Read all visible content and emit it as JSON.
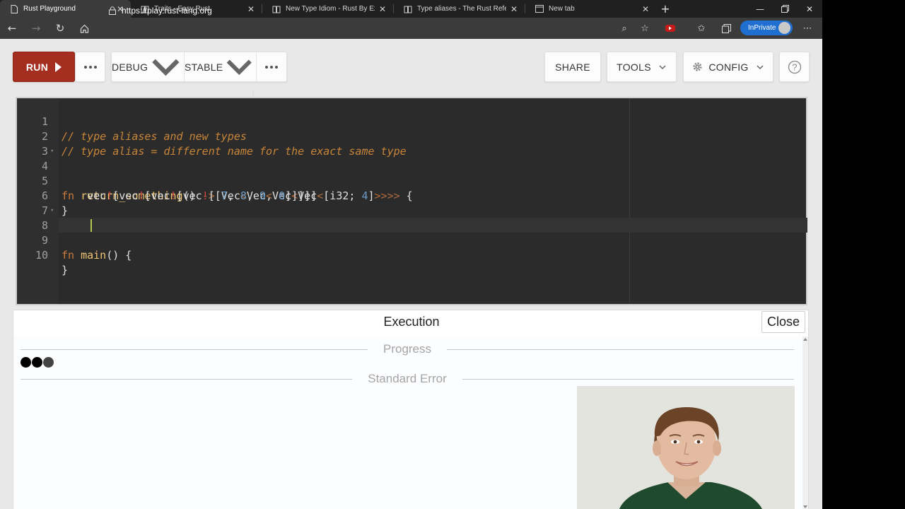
{
  "browser": {
    "tabs": [
      {
        "title": "Rust Playground",
        "active": true
      },
      {
        "title": "Traits - Easy Rust",
        "active": false
      },
      {
        "title": "New Type Idiom - Rust By Example",
        "active": false
      },
      {
        "title": "Type aliases - The Rust Reference",
        "active": false
      },
      {
        "title": "New tab",
        "active": false
      }
    ],
    "url": "https://play.rust-lang.org",
    "inprivate_label": "InPrivate"
  },
  "toolbar": {
    "run_label": "RUN",
    "debug_label": "DEBUG",
    "stable_label": "STABLE",
    "share_label": "SHARE",
    "tools_label": "TOOLS",
    "config_label": "CONFIG",
    "help_label": "?"
  },
  "editor": {
    "lines": [
      {
        "n": "1",
        "fold": false
      },
      {
        "n": "2",
        "fold": false
      },
      {
        "n": "3",
        "fold": false
      },
      {
        "n": "4",
        "fold": true
      },
      {
        "n": "5",
        "fold": false
      },
      {
        "n": "6",
        "fold": false
      },
      {
        "n": "7",
        "fold": false
      },
      {
        "n": "8",
        "fold": true
      },
      {
        "n": "9",
        "fold": false
      },
      {
        "n": "10",
        "fold": false
      }
    ],
    "code": {
      "l1": "// type aliases and new types",
      "l2": "// type alias = different name for the exact same type",
      "l4_kw": "fn",
      "l4_name": "return_something",
      "l4_parens": "()",
      "l4_arrow": "->",
      "l4_vec1": "Vec",
      "l4_vec2": "Vec",
      "l4_vec3": "Vec",
      "l4_vec4": "Vec",
      "l4_lt": "<",
      "l4_arr_open": "[i32; ",
      "l4_num": "4",
      "l4_arr_close": "]",
      "l4_gt": ">>>>",
      "l4_brace": " {",
      "l5_vec": "vec",
      "l5_bang": "!",
      "l5_open": "[",
      "l5_nums": [
        "7",
        "8",
        "9",
        "0"
      ],
      "l5_close": "]]]]]",
      "l6": "}",
      "l8_kw": "fn",
      "l8_name": "main",
      "l8_rest": "() {",
      "l10": "}"
    }
  },
  "output": {
    "title": "Execution",
    "close_label": "Close",
    "progress_label": "Progress",
    "stderr_label": "Standard Error"
  },
  "colors": {
    "run_button": "#a42f20",
    "editor_bg": "#2b2b2b",
    "comment": "#c8853a",
    "number": "#6a9bc8",
    "macro_bang": "#d2413a",
    "inprivate": "#1f6fd1"
  }
}
